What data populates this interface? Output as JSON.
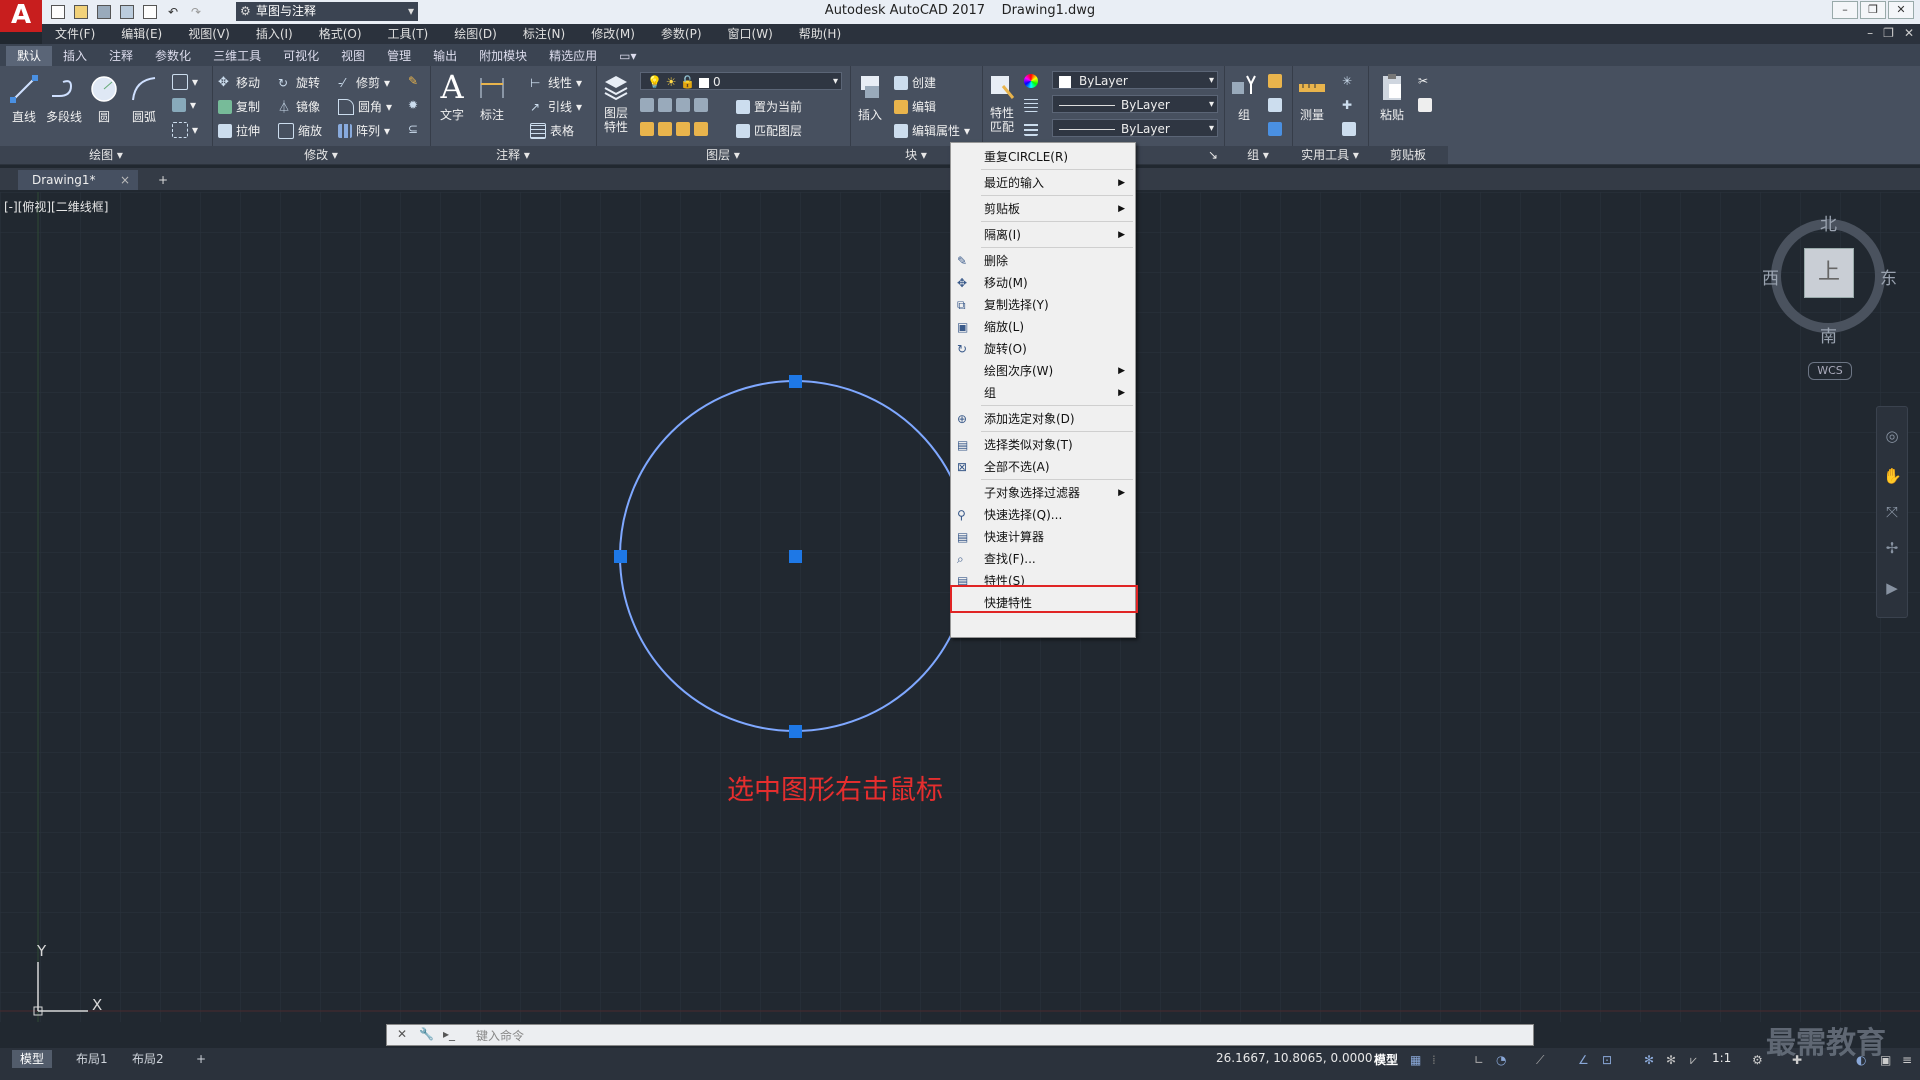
{
  "title_bar": {
    "app_name": "Autodesk AutoCAD 2017",
    "document": "Drawing1.dwg",
    "workspace": "草图与注释"
  },
  "menus": [
    "文件(F)",
    "编辑(E)",
    "视图(V)",
    "插入(I)",
    "格式(O)",
    "工具(T)",
    "绘图(D)",
    "标注(N)",
    "修改(M)",
    "参数(P)",
    "窗口(W)",
    "帮助(H)"
  ],
  "ribbon_tabs": [
    "默认",
    "插入",
    "注释",
    "参数化",
    "三维工具",
    "可视化",
    "视图",
    "管理",
    "输出",
    "附加模块",
    "精选应用"
  ],
  "ribbon": {
    "draw": {
      "title": "绘图",
      "line": "直线",
      "polyline": "多段线",
      "circle": "圆",
      "arc": "圆弧"
    },
    "modify": {
      "title": "修改",
      "move": "移动",
      "rotate": "旋转",
      "trim": "修剪",
      "copy": "复制",
      "mirror": "镜像",
      "fillet": "圆角",
      "stretch": "拉伸",
      "scale": "缩放",
      "array": "阵列"
    },
    "annotation": {
      "title": "注释",
      "text": "文字",
      "dimension": "标注",
      "linear": "线性",
      "leader": "引线",
      "table": "表格"
    },
    "layers": {
      "title": "图层",
      "layer_props": "图层特性",
      "current_layer": "0",
      "set_current": "置为当前",
      "match_layer": "匹配图层"
    },
    "block": {
      "title": "块",
      "insert": "插入",
      "create": "创建",
      "edit": "编辑",
      "edit_attr": "编辑属性"
    },
    "properties": {
      "match": "特性匹配",
      "color": "ByLayer",
      "linetype": "ByLayer",
      "lineweight": "ByLayer"
    },
    "groups": {
      "title": "组",
      "group": "组"
    },
    "utilities": {
      "title": "实用工具",
      "measure": "测量"
    },
    "clipboard": {
      "title": "剪贴板",
      "paste": "粘贴"
    }
  },
  "file_tab": {
    "name": "Drawing1*",
    "close": "×",
    "new": "+"
  },
  "viewport_label": "[-][俯视][二维线框]",
  "viewcube": {
    "north": "北",
    "south": "南",
    "east": "东",
    "west": "西",
    "top": "上",
    "wcs": "WCS"
  },
  "context_menu": {
    "items": [
      {
        "label": "重复CIRCLE(R)",
        "sub": false
      },
      {
        "label": "最近的输入",
        "sub": true
      },
      {
        "label": "剪贴板",
        "sub": true
      },
      {
        "label": "隔离(I)",
        "sub": true
      },
      {
        "label": "删除",
        "sub": false
      },
      {
        "label": "移动(M)",
        "sub": false
      },
      {
        "label": "复制选择(Y)",
        "sub": false
      },
      {
        "label": "缩放(L)",
        "sub": false
      },
      {
        "label": "旋转(O)",
        "sub": false
      },
      {
        "label": "绘图次序(W)",
        "sub": true
      },
      {
        "label": "组",
        "sub": true
      },
      {
        "label": "添加选定对象(D)",
        "sub": false
      },
      {
        "label": "选择类似对象(T)",
        "sub": false
      },
      {
        "label": "全部不选(A)",
        "sub": false
      },
      {
        "label": "子对象选择过滤器",
        "sub": true
      },
      {
        "label": "快速选择(Q)...",
        "sub": false
      },
      {
        "label": "快速计算器",
        "sub": false
      },
      {
        "label": "查找(F)...",
        "sub": false
      },
      {
        "label": "特性(S)",
        "sub": false
      },
      {
        "label": "快捷特性",
        "sub": false
      }
    ],
    "highlighted": "特性(S)"
  },
  "annotation_text": "选中图形右击鼠标",
  "ucs": {
    "x": "X",
    "y": "Y"
  },
  "command_line": {
    "placeholder": "键入命令"
  },
  "status": {
    "layouts": [
      "模型",
      "布局1",
      "布局2"
    ],
    "add_layout": "+",
    "coordinates": "26.1667, 10.8065, 0.0000",
    "mode": "模型",
    "scale": "1:1"
  },
  "watermark": "最需教育",
  "colors": {
    "canvas": "#212830",
    "ribbon": "#47505f",
    "circle": "#7fa8ff",
    "grip": "#1e78e6",
    "highlight": "#e02424",
    "annotation": "#e52e2e"
  }
}
